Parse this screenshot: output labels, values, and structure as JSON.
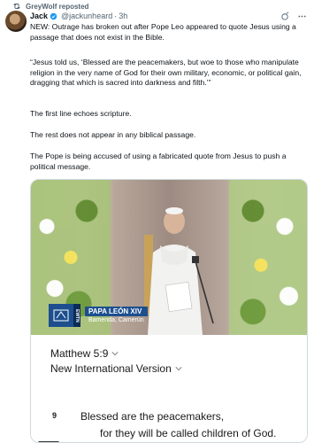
{
  "repost": {
    "label": "GreyWolf reposted",
    "icon": "repost-icon"
  },
  "post": {
    "author_name": "Jack",
    "handle": "@jackunheard",
    "separator": "·",
    "time": "3h",
    "icons": [
      "verified-badge-icon",
      "grok-icon",
      "more-icon"
    ],
    "paragraphs": [
      "NEW: Outrage has broken out after Pope Leo appeared to quote Jesus using a passage that does not exist in the Bible.",
      "“Jesus told us, ‘Blessed are the peacemakers, but woe to those who manipulate religion in the very name of God for their own military, economic, or political gain, dragging that which is sacred into darkness and filth.’”",
      "The first line echoes scripture.",
      "The rest does not appear in any biblical passage.",
      "The Pope is being accused of using a fabricated quote from Jesus to push a political message."
    ]
  },
  "video": {
    "channel_label": "EWTN",
    "title": "PAPA LEÓN XIV",
    "location": "Bamenda, Camerún"
  },
  "bible": {
    "reference": "Matthew 5:9",
    "version": "New International Version",
    "verse_number": "9",
    "verse_line1": "Blessed are the peacemakers,",
    "verse_line2": "for they will be called children of God."
  },
  "colors": {
    "text": "#0f1419",
    "muted": "#536471",
    "verified": "#1d9bf0",
    "lower_third": "#1d4f8f"
  }
}
